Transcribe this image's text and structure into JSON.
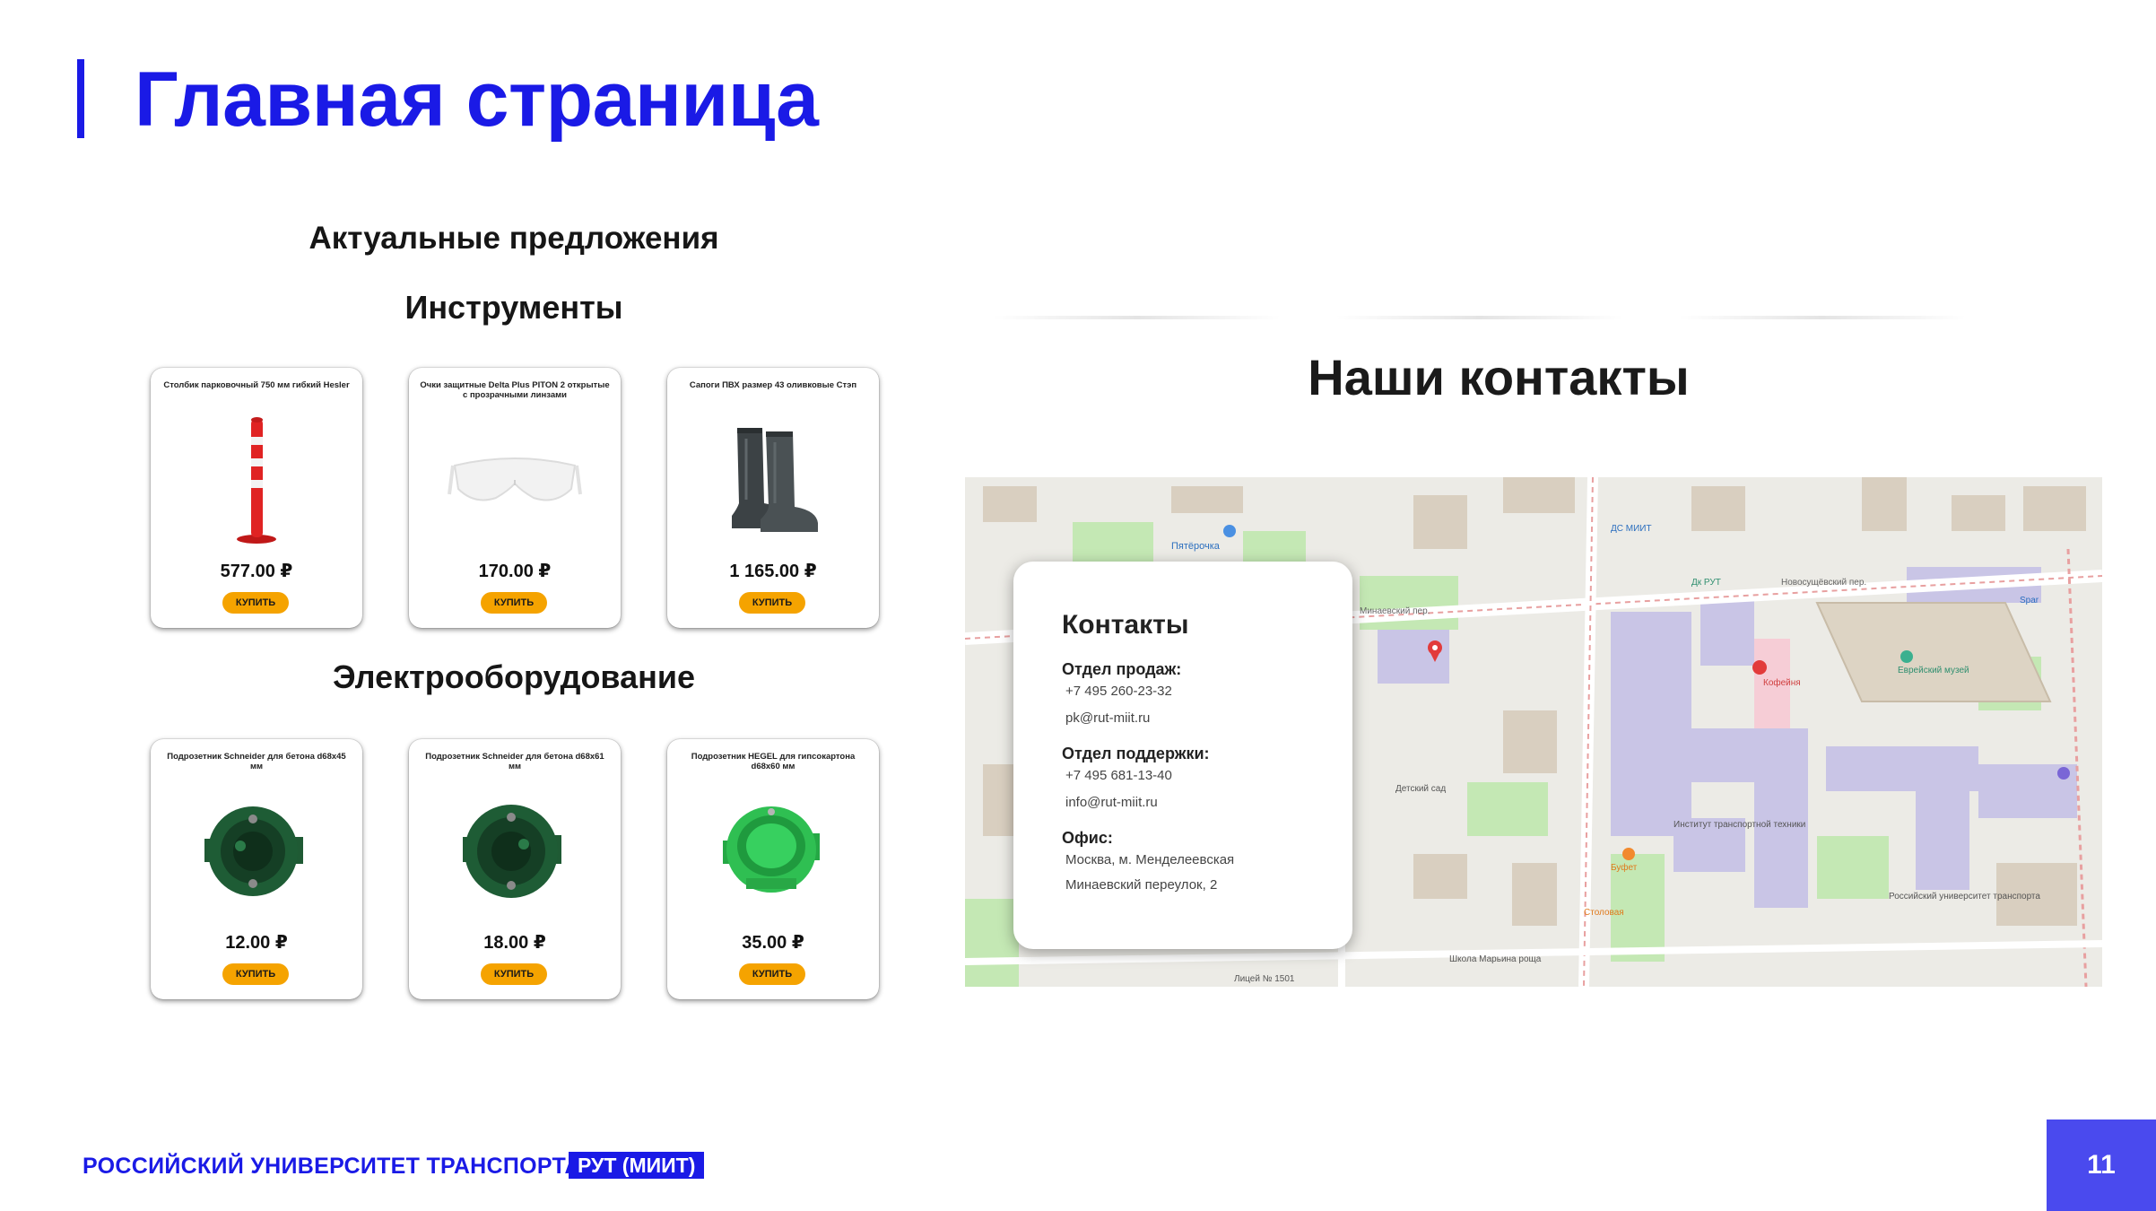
{
  "slide": {
    "title": "Главная страница",
    "page_number": "11"
  },
  "offers": {
    "heading": "Актуальные предложения",
    "categories": [
      {
        "name": "Инструменты",
        "products": [
          {
            "name": "Столбик парковочный 750 мм гибкий Hesler",
            "price": "577.00 ₽",
            "buy_label": "КУПИТЬ",
            "image_icon": "parking-post-icon"
          },
          {
            "name": "Очки защитные Delta Plus PITON 2 открытые с прозрачными линзами",
            "price": "170.00 ₽",
            "buy_label": "КУПИТЬ",
            "image_icon": "safety-glasses-icon"
          },
          {
            "name": "Сапоги ПВХ размер 43 оливковые Стэп",
            "price": "1 165.00 ₽",
            "buy_label": "КУПИТЬ",
            "image_icon": "rubber-boots-icon"
          }
        ]
      },
      {
        "name": "Электрооборудование",
        "products": [
          {
            "name": "Подрозетник Schneider для бетона d68x45 мм",
            "price": "12.00 ₽",
            "buy_label": "КУПИТЬ",
            "image_icon": "socket-box-icon"
          },
          {
            "name": "Подрозетник Schneider для бетона d68x61 мм",
            "price": "18.00 ₽",
            "buy_label": "КУПИТЬ",
            "image_icon": "socket-box-icon"
          },
          {
            "name": "Подрозетник HEGEL для гипсокартона d68x60 мм",
            "price": "35.00 ₽",
            "buy_label": "КУПИТЬ",
            "image_icon": "socket-box-light-icon"
          }
        ]
      }
    ]
  },
  "contacts": {
    "heading": "Наши контакты",
    "card": {
      "title": "Контакты",
      "sales_label": "Отдел продаж:",
      "sales_phone": "+7 495 260-23-32",
      "sales_email": "pk@rut-miit.ru",
      "support_label": "Отдел поддержки:",
      "support_phone": "+7 495 681-13-40",
      "support_email": "info@rut-miit.ru",
      "office_label": "Офис:",
      "office_line1": "Москва, м. Менделеевская",
      "office_line2": "Минаевский переулок, 2"
    },
    "map": {
      "labels": [
        "Пятёрочка",
        "Минаевский пер.",
        "Новосущёвский пер.",
        "Еврейский музей",
        "Детский сад",
        "Институт транспортной техники",
        "Буфет",
        "Столовая",
        "Российский университет транспорта",
        "Школа Марьина роща",
        "ДС МИИТ",
        "Дк РУТ",
        "Лицей № 1501",
        "Spar",
        "Кофейня"
      ]
    }
  },
  "footer": {
    "university": "РОССИЙСКИЙ УНИВЕРСИТЕТ ТРАНСПОРТА",
    "badge": "РУТ (МИИТ)"
  },
  "colors": {
    "brand_blue": "#1a1ae6",
    "page_box": "#4a4aee",
    "buy_button": "#f5a300",
    "map_building_lilac": "#c9c5e6",
    "map_park_green": "#c4e8b4",
    "map_road_red": "#e8a0a0"
  }
}
